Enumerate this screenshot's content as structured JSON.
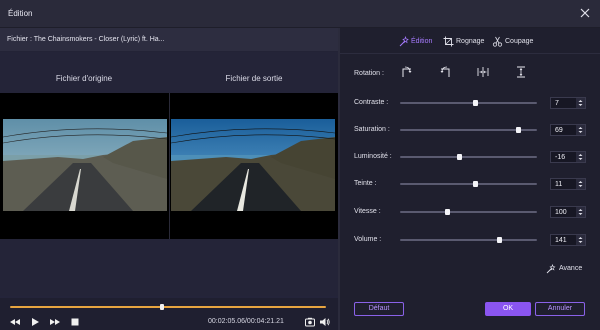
{
  "window": {
    "title": "Édition"
  },
  "file": {
    "label": "Fichier : The Chainsmokers - Closer (Lyric) ft. Ha..."
  },
  "preview": {
    "original_label": "Fichier d'origine",
    "output_label": "Fichier de sortie"
  },
  "player": {
    "time": "00:02:05.06/00:04:21.21",
    "progress_fraction": 0.48
  },
  "tabs": [
    {
      "label": "Édition",
      "active": true,
      "icon": "magic-wand-icon"
    },
    {
      "label": "Rognage",
      "active": false,
      "icon": "crop-icon"
    },
    {
      "label": "Coupage",
      "active": false,
      "icon": "scissors-icon"
    }
  ],
  "rotation": {
    "label": "Rotation :"
  },
  "adjustments": [
    {
      "label": "Contraste :",
      "value": "7",
      "fraction": 0.55
    },
    {
      "label": "Saturation :",
      "value": "69",
      "fraction": 0.86
    },
    {
      "label": "Luminosité :",
      "value": "-16",
      "fraction": 0.43
    },
    {
      "label": "Teinte :",
      "value": "11",
      "fraction": 0.55
    },
    {
      "label": "Vitesse :",
      "value": "100",
      "fraction": 0.34
    },
    {
      "label": "Volume :",
      "value": "141",
      "fraction": 0.72
    }
  ],
  "advanced": {
    "label": "Avance"
  },
  "buttons": {
    "default": "Défaut",
    "ok": "OK",
    "cancel": "Annuler"
  },
  "colors": {
    "accent": "#8a55f0",
    "progress": "#e6a440",
    "panel": "#1f1f2e"
  }
}
